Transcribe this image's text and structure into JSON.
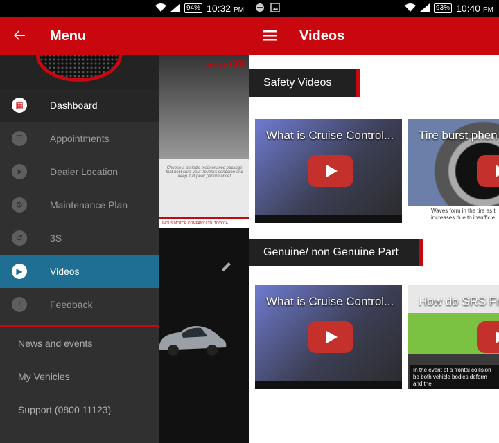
{
  "left_screen": {
    "status": {
      "battery": "94%",
      "time": "10:32",
      "time_suffix": "PM"
    },
    "appbar": {
      "title": "Menu"
    },
    "drawer": {
      "items": [
        {
          "label": "Dashboard",
          "icon": "dashboard-icon",
          "glyph": "▦"
        },
        {
          "label": "Appointments",
          "icon": "appointments-icon",
          "glyph": "☰"
        },
        {
          "label": "Dealer Location",
          "icon": "location-arrow-icon",
          "glyph": "➤"
        },
        {
          "label": "Maintenance Plan",
          "icon": "maintenance-icon",
          "glyph": "⚙"
        },
        {
          "label": "3S",
          "icon": "3s-icon",
          "glyph": "↺"
        },
        {
          "label": "Videos",
          "icon": "video-icon",
          "glyph": "▶"
        },
        {
          "label": "Feedback",
          "icon": "feedback-icon",
          "glyph": "!"
        }
      ],
      "sub_items": [
        {
          "label": "News and events"
        },
        {
          "label": "My Vehicles"
        },
        {
          "label": "Support (0800 11123)"
        }
      ]
    },
    "background": {
      "poster_logo": "TOYOTA\nGENUINE PARTS",
      "poster_text": "Choose a periodic maintenance package that best suits your Toyota's condition and keep it at peak performance!",
      "poster_footer": "INDUS MOTOR COMPANY LTD.    TOYOTA"
    }
  },
  "right_screen": {
    "status": {
      "battery": "93%",
      "time": "10:40",
      "time_suffix": "PM"
    },
    "appbar": {
      "title": "Videos"
    },
    "sections": [
      {
        "title": "Safety Videos",
        "videos": [
          {
            "title": "What is Cruise Control...",
            "caption": ""
          },
          {
            "title": "Tire burst phen",
            "caption": "Waves form in the tire as t increases due to insufficie"
          }
        ]
      },
      {
        "title": "Genuine/ non Genuine Part",
        "videos": [
          {
            "title": "What is Cruise Control...",
            "caption": ""
          },
          {
            "title": "How do SRS Fr",
            "caption": "In the event of a frontal collision be both vehicle bodies deform and the"
          }
        ]
      }
    ]
  },
  "colors": {
    "brand_red": "#c8070f",
    "active_blue": "#1f6f94",
    "drawer_bg": "#303030",
    "section_bg": "#212121"
  }
}
